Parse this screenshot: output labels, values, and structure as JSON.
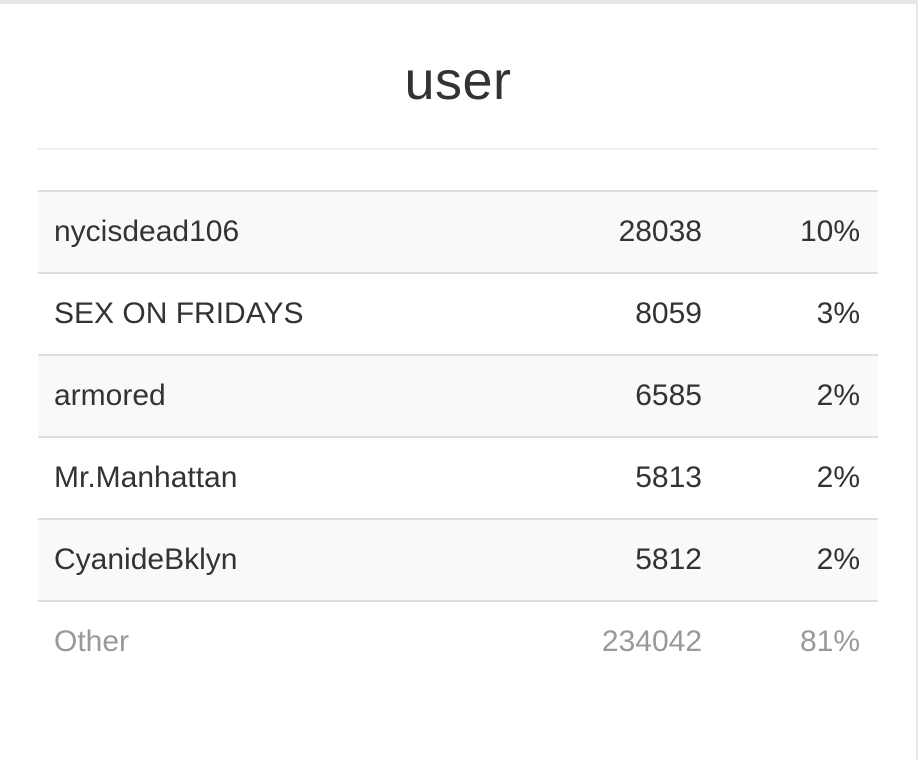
{
  "widget": {
    "title": "user"
  },
  "table": {
    "rows": [
      {
        "name": "nycisdead106",
        "count": "28038",
        "percent": "10%"
      },
      {
        "name": "SEX ON FRIDAYS",
        "count": "8059",
        "percent": "3%"
      },
      {
        "name": "armored",
        "count": "6585",
        "percent": "2%"
      },
      {
        "name": "Mr.Manhattan",
        "count": "5813",
        "percent": "2%"
      },
      {
        "name": "CyanideBklyn",
        "count": "5812",
        "percent": "2%"
      }
    ],
    "other": {
      "name": "Other",
      "count": "234042",
      "percent": "81%"
    }
  },
  "colors": {
    "text": "#333333",
    "muted_text": "#999999",
    "stripe": "#f9f9f9",
    "rule": "#dddddd"
  }
}
